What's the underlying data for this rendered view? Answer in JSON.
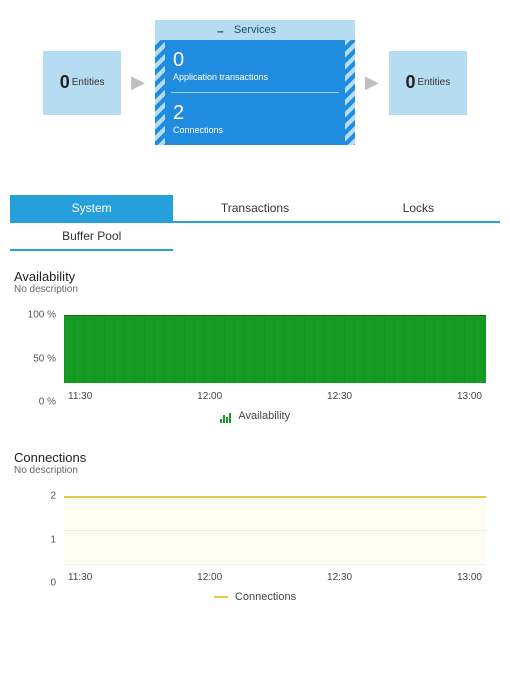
{
  "flow": {
    "left": {
      "count": "0",
      "label": "Entities"
    },
    "right": {
      "count": "0",
      "label": "Entities"
    },
    "center": {
      "title": "Services",
      "metrics": [
        {
          "value": "0",
          "label": "Application transactions"
        },
        {
          "value": "2",
          "label": "Connections"
        }
      ]
    }
  },
  "tabs": {
    "items": [
      "System",
      "Transactions",
      "Locks"
    ],
    "sub": [
      "Buffer Pool"
    ]
  },
  "sections": {
    "availability": {
      "title": "Availability",
      "desc": "No description",
      "legend": "Availability"
    },
    "connections": {
      "title": "Connections",
      "desc": "No description",
      "legend": "Connections"
    }
  },
  "chart_data": [
    {
      "type": "bar",
      "id": "availability",
      "title": "Availability",
      "xlabel": "",
      "ylabel": "",
      "ylim": [
        0,
        100
      ],
      "yticks": [
        "100 %",
        "50 %",
        "0 %"
      ],
      "xticks": [
        "11:30",
        "12:00",
        "12:30",
        "13:00"
      ],
      "series": [
        {
          "name": "Availability",
          "color": "#159b21",
          "value_constant": 100,
          "time_range": [
            "11:12",
            "13:12"
          ]
        }
      ]
    },
    {
      "type": "line",
      "id": "connections",
      "title": "Connections",
      "xlabel": "",
      "ylabel": "",
      "ylim": [
        0,
        2
      ],
      "yticks": [
        "2",
        "1",
        "0"
      ],
      "xticks": [
        "11:30",
        "12:00",
        "12:30",
        "13:00"
      ],
      "series": [
        {
          "name": "Connections",
          "color": "#e6c84b",
          "value_constant": 2,
          "time_range": [
            "11:12",
            "13:12"
          ]
        }
      ]
    }
  ]
}
